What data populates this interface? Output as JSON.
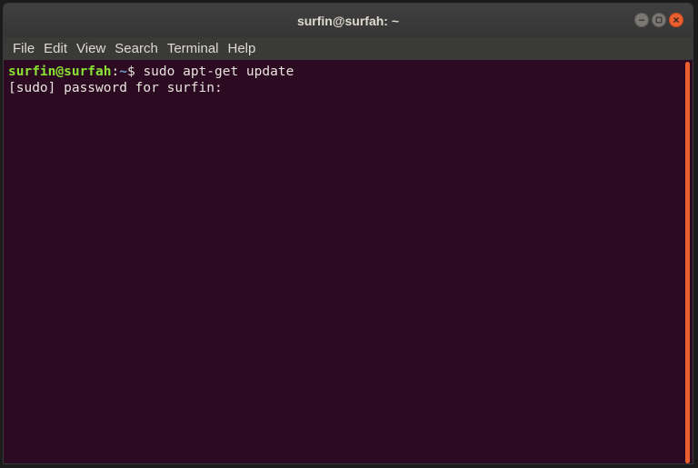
{
  "window": {
    "title": "surfin@surfah: ~"
  },
  "menu": {
    "items": [
      "File",
      "Edit",
      "View",
      "Search",
      "Terminal",
      "Help"
    ]
  },
  "terminal": {
    "prompt_user": "surfin@surfah",
    "prompt_sep": ":",
    "prompt_path": "~",
    "prompt_symbol": "$ ",
    "command": "sudo apt-get update",
    "output_line": "[sudo] password for surfin:"
  },
  "colors": {
    "terminal_bg": "#2c0a22",
    "prompt_user": "#8ae234",
    "prompt_path": "#729fcf",
    "close_button": "#ea5f2d",
    "accent": "#ea5f2d"
  },
  "icons": {
    "minimize": "minimize-icon",
    "maximize": "maximize-icon",
    "close": "close-icon"
  }
}
